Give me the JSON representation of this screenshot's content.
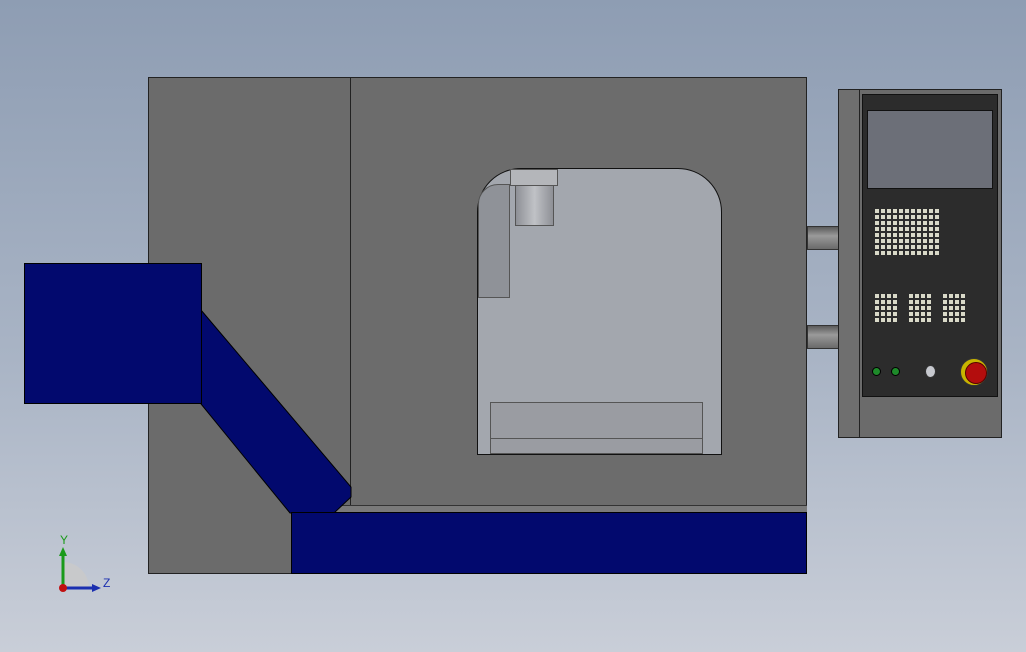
{
  "triad": {
    "y_label": "Y",
    "z_label": "Z"
  },
  "colors": {
    "background_top": "#8e9db3",
    "machine_gray": "#6b6b6b",
    "part_blue": "#02096e",
    "window_glass": "#a3a7ae",
    "estop_red": "#b30d0d",
    "estop_ring": "#c8b400",
    "indicator_green": "#1e8a2a"
  },
  "icons": [
    "axis-triad-icon",
    "emergency-stop-icon"
  ]
}
